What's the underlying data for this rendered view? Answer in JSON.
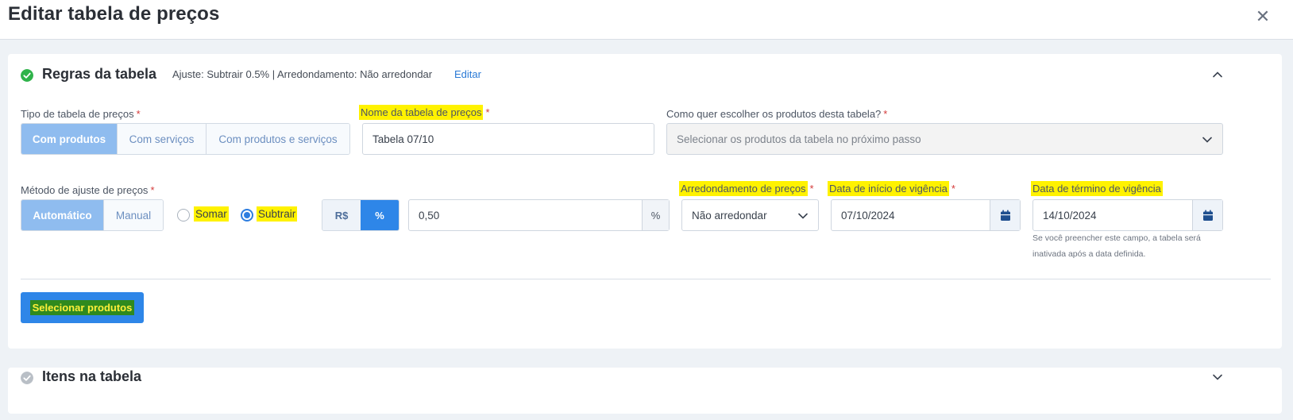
{
  "modal": {
    "title": "Editar tabela de preços",
    "close_icon": "close-icon"
  },
  "rules_section": {
    "title": "Regras da tabela",
    "summary": "Ajuste: Subtrair 0.5% | Arredondamento: Não arredondar",
    "edit_label": "Editar",
    "status_color": "#2fb34a"
  },
  "fields": {
    "tipo_label": "Tipo de tabela de preços",
    "tipo_options": [
      "Com produtos",
      "Com serviços",
      "Com produtos e serviços"
    ],
    "nome_label": "Nome da tabela de preços",
    "nome_value": "Tabela 07/10",
    "escolha_label": "Como quer escolher os produtos desta tabela?",
    "escolha_value": "Selecionar os produtos da tabela no próximo passo",
    "metodo_label": "Método de ajuste de preços",
    "metodo_options": [
      "Automático",
      "Manual"
    ],
    "somar_label": "Somar",
    "subtrair_label": "Subtrair",
    "unit_options": [
      "R$",
      "%"
    ],
    "ajuste_value": "0,50",
    "ajuste_suffix": "%",
    "arred_label": "Arredondamento de preços",
    "arred_value": "Não arredondar",
    "inicio_label": "Data de início de vigência",
    "inicio_value": "07/10/2024",
    "termino_label": "Data de término de vigência",
    "termino_value": "14/10/2024",
    "termino_hint": "Se você preencher este campo, a tabela será inativada após a data definida.",
    "required_mark": "*"
  },
  "primary_button": "Selecionar produtos",
  "items_section": {
    "title": "Itens na tabela",
    "status_color": "#b9bfc6"
  },
  "colors": {
    "accent": "#2e86e8",
    "accent_light": "#8fbcef",
    "highlight": "#fff200"
  }
}
